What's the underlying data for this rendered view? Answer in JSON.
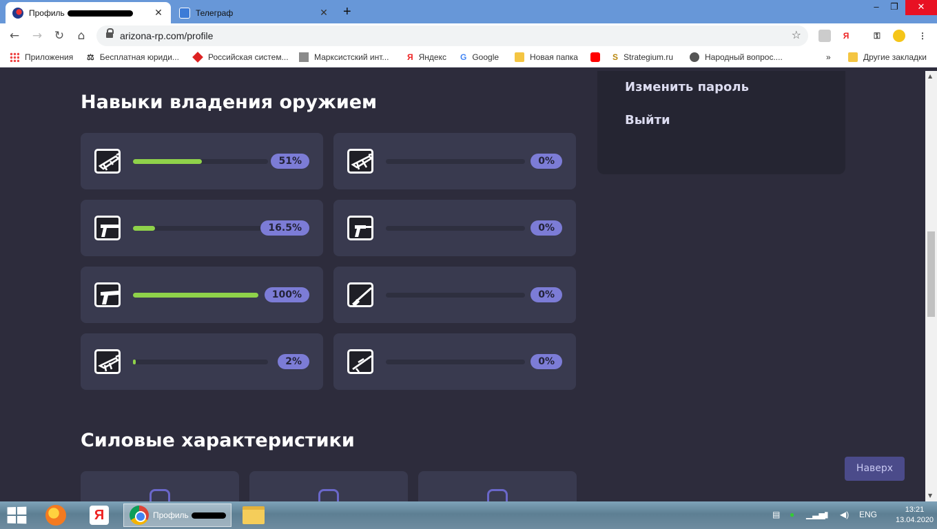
{
  "browser": {
    "tabs": [
      {
        "title": "Профиль",
        "icon": "arizona-favicon",
        "active": true
      },
      {
        "title": "Телеграф",
        "icon": "telegraph-favicon",
        "active": false
      }
    ],
    "new_tab": "+",
    "window_controls": {
      "minimize": "–",
      "restore": "❐",
      "close": "✕"
    },
    "nav": {
      "back": "←",
      "forward": "→",
      "reload": "↻",
      "home": "⌂"
    },
    "url": "arizona-rp.com/profile",
    "star": "☆",
    "extensions": [
      "translate-icon",
      "yandex-icon",
      "key-icon",
      "avatar-icon",
      "menu-icon"
    ],
    "ext_labels": {
      "yandex": "Я",
      "key": "⚿",
      "menu": "⋮"
    }
  },
  "bookmarks": [
    {
      "label": "Приложения",
      "icon": "apps-icon"
    },
    {
      "label": "Бесплатная юриди...",
      "icon": "scales-icon"
    },
    {
      "label": "Российская систем...",
      "icon": "red-badge-icon"
    },
    {
      "label": "Марксистский инт...",
      "icon": "image-icon"
    },
    {
      "label": "Яндекс",
      "icon": "yandex-icon"
    },
    {
      "label": "Google",
      "icon": "google-icon"
    },
    {
      "label": "Новая папка",
      "icon": "folder-icon"
    },
    {
      "label": "",
      "icon": "youtube-icon"
    },
    {
      "label": "Strategium.ru",
      "icon": "strategium-icon"
    },
    {
      "label": "Народный вопрос....",
      "icon": "globe-icon"
    },
    {
      "label": "»",
      "icon": "more-icon"
    },
    {
      "label": "Другие закладки",
      "icon": "folder-icon"
    }
  ],
  "page": {
    "skills_title": "Навыки владения оружием",
    "power_title": "Силовые характеристики",
    "side_menu": {
      "change_password": "Изменить пароль",
      "logout": "Выйти"
    },
    "back_to_top": "Наверх",
    "weapons": [
      {
        "icon": "m4-rifle-icon",
        "percent_label": "51%",
        "value": 51
      },
      {
        "icon": "ak47-rifle-icon",
        "percent_label": "0%",
        "value": 0
      },
      {
        "icon": "pistol-icon",
        "percent_label": "16.5%",
        "value": 16.5
      },
      {
        "icon": "silenced-pistol-icon",
        "percent_label": "0%",
        "value": 0
      },
      {
        "icon": "desert-eagle-icon",
        "percent_label": "100%",
        "value": 100
      },
      {
        "icon": "shotgun-icon",
        "percent_label": "0%",
        "value": 0
      },
      {
        "icon": "smg-icon",
        "percent_label": "2%",
        "value": 2
      },
      {
        "icon": "sniper-rifle-icon",
        "percent_label": "0%",
        "value": 0
      }
    ],
    "power_stats": [
      {
        "icon": "fist-icon"
      },
      {
        "icon": "arm-icon"
      },
      {
        "icon": "runner-icon"
      }
    ]
  },
  "taskbar": {
    "active_app_label": "Профиль",
    "apps": [
      "start-icon",
      "firefox-icon",
      "yandex-browser-icon",
      "chrome-icon",
      "file-explorer-icon"
    ],
    "language": "ENG",
    "time": "13:21",
    "date": "13.04.2020"
  },
  "colors": {
    "page_bg": "#2d2c3c",
    "card_bg": "#393a4f",
    "progress_fill": "#8fd24a",
    "badge_bg": "#7c7cd6",
    "tab_strip": "#6797d8"
  }
}
